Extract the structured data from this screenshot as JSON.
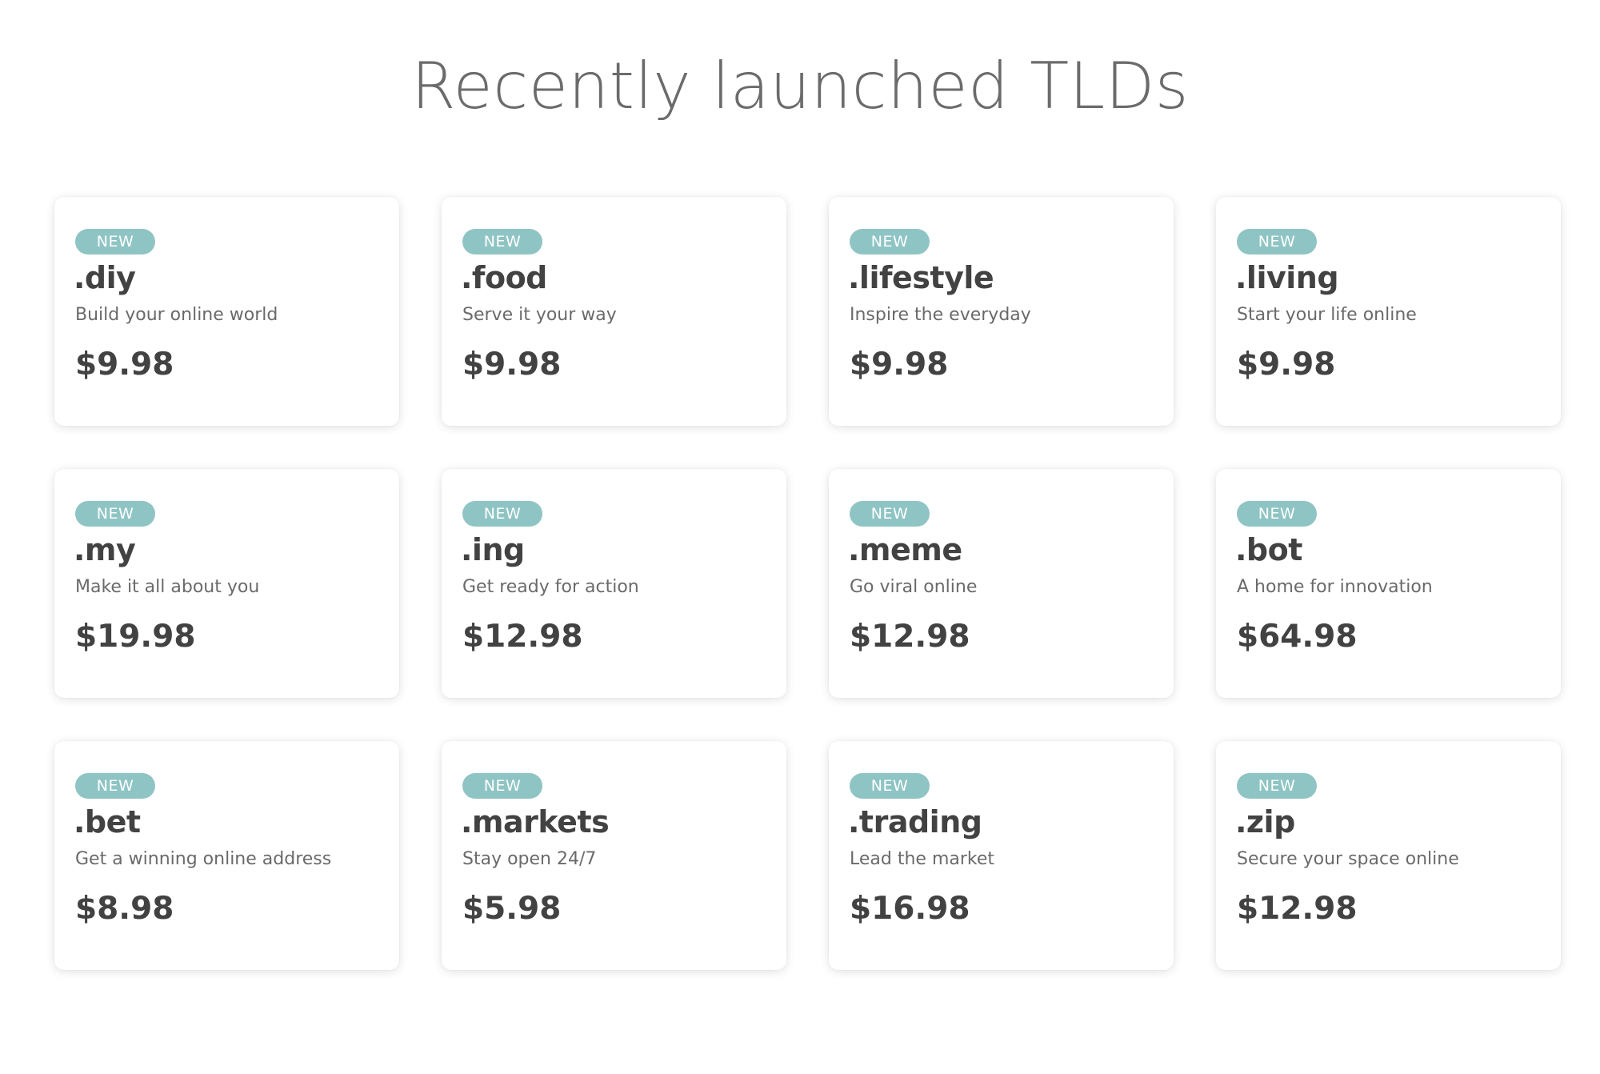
{
  "title": "Recently launched TLDs",
  "colors": {
    "badge": "#8fc4c4",
    "heading": "#6b6b6b",
    "text": "#424242"
  },
  "cards": [
    {
      "badge": "NEW",
      "tld": ".diy",
      "tagline": "Build your online world",
      "price": "$9.98"
    },
    {
      "badge": "NEW",
      "tld": ".food",
      "tagline": "Serve it your way",
      "price": "$9.98"
    },
    {
      "badge": "NEW",
      "tld": ".lifestyle",
      "tagline": "Inspire the everyday",
      "price": "$9.98"
    },
    {
      "badge": "NEW",
      "tld": ".living",
      "tagline": "Start your life online",
      "price": "$9.98"
    },
    {
      "badge": "NEW",
      "tld": ".my",
      "tagline": "Make it all about you",
      "price": "$19.98"
    },
    {
      "badge": "NEW",
      "tld": ".ing",
      "tagline": "Get ready for action",
      "price": "$12.98"
    },
    {
      "badge": "NEW",
      "tld": ".meme",
      "tagline": "Go viral online",
      "price": "$12.98"
    },
    {
      "badge": "NEW",
      "tld": ".bot",
      "tagline": "A home for innovation",
      "price": "$64.98"
    },
    {
      "badge": "NEW",
      "tld": ".bet",
      "tagline": "Get a winning online address",
      "price": "$8.98"
    },
    {
      "badge": "NEW",
      "tld": ".markets",
      "tagline": "Stay open 24/7",
      "price": "$5.98"
    },
    {
      "badge": "NEW",
      "tld": ".trading",
      "tagline": "Lead the market",
      "price": "$16.98"
    },
    {
      "badge": "NEW",
      "tld": ".zip",
      "tagline": "Secure your space online",
      "price": "$12.98"
    }
  ]
}
